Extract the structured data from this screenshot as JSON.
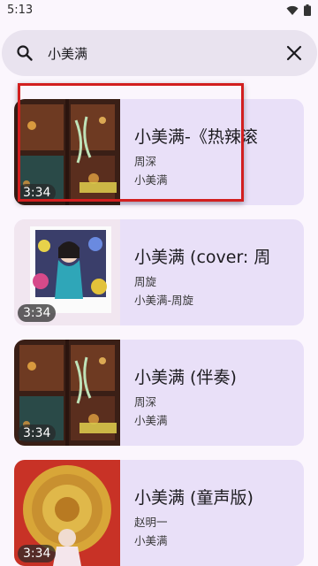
{
  "status": {
    "time": "5:13"
  },
  "search": {
    "value": "小美满"
  },
  "results": [
    {
      "title": "小美满-《热辣滚",
      "artist": "周深",
      "album": "小美满",
      "duration": "3:34"
    },
    {
      "title": "小美满 (cover: 周",
      "artist": "周旋",
      "album": "小美满-周旋",
      "duration": "3:34"
    },
    {
      "title": "小美满 (伴奏)",
      "artist": "周深",
      "album": "小美满",
      "duration": "3:34"
    },
    {
      "title": "小美满 (童声版)",
      "artist": "赵明一",
      "album": "小美满",
      "duration": "3:34"
    }
  ],
  "colors": {
    "card_bg": "#e9e0f8",
    "search_bg": "#e9e3ef",
    "highlight": "#d21f1f"
  }
}
